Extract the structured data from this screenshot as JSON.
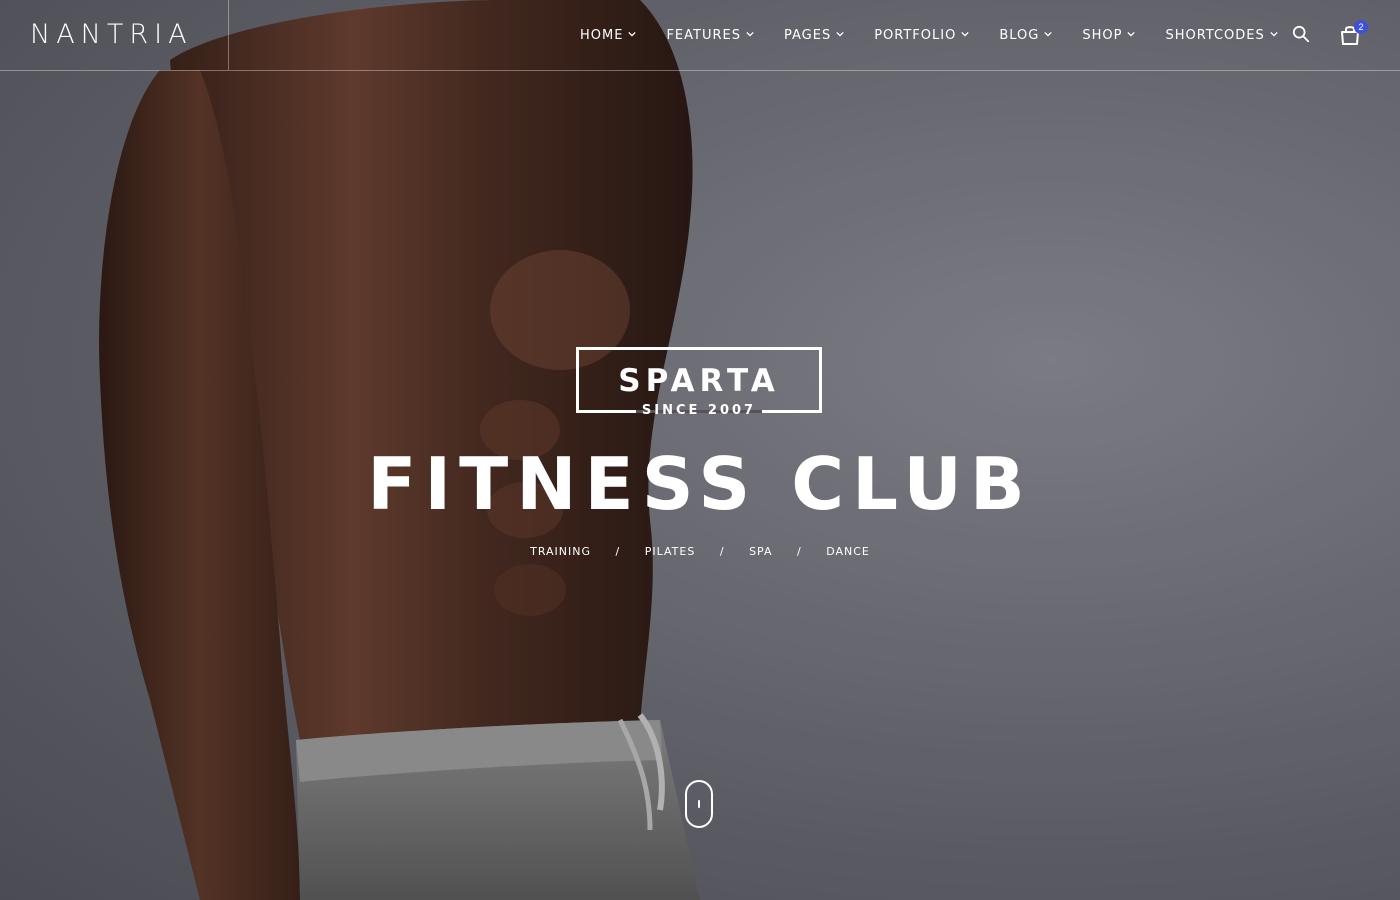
{
  "header": {
    "logo": "NANTRIA",
    "nav": [
      {
        "label": "HOME"
      },
      {
        "label": "FEATURES"
      },
      {
        "label": "PAGES"
      },
      {
        "label": "PORTFOLIO"
      },
      {
        "label": "BLOG"
      },
      {
        "label": "SHOP"
      },
      {
        "label": "SHORTCODES"
      }
    ],
    "cart_count": "2",
    "icons": [
      "search-icon",
      "cart-icon",
      "chevron-down-icon"
    ]
  },
  "hero": {
    "badge_title": "SPARTA",
    "badge_subtitle": "SINCE 2007",
    "title": "FITNESS CLUB",
    "services": [
      "TRAINING",
      "PILATES",
      "SPA",
      "DANCE"
    ],
    "separator": "/"
  },
  "colors": {
    "text": "#ffffff",
    "background": "#6b6b73",
    "badge": "#3f51d9"
  }
}
